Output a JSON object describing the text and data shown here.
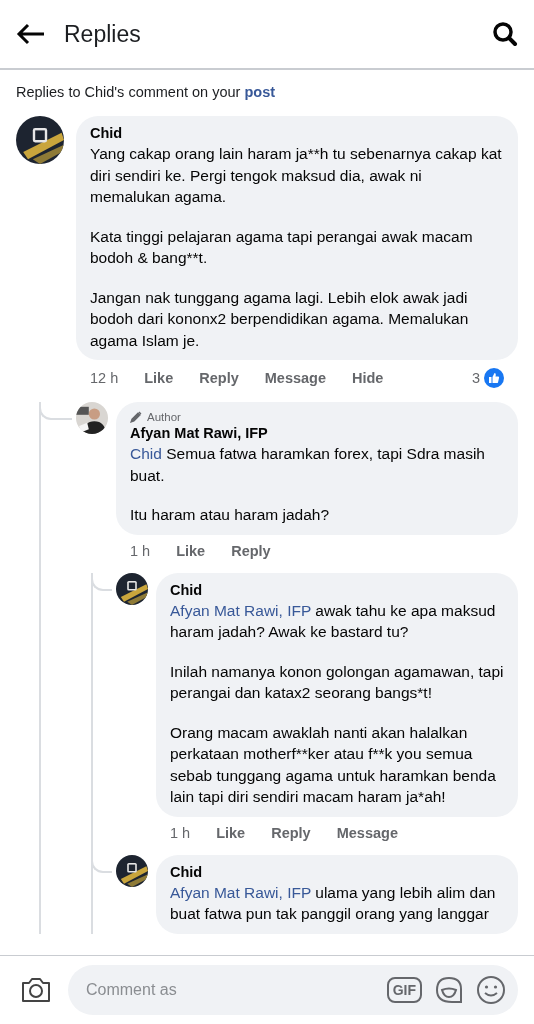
{
  "header": {
    "title": "Replies"
  },
  "context": {
    "text": "Replies to Chid's comment on your",
    "link": "post"
  },
  "comments": [
    {
      "author": "Chid",
      "paragraphs": [
        "Yang cakap orang lain haram ja**h tu sebenarnya cakap kat diri sendiri ke. Pergi tengok maksud dia, awak ni memalukan agama.",
        "Kata tinggi pelajaran agama tapi perangai awak macam bodoh & bang**t.",
        "Jangan nak tunggang agama lagi. Lebih elok awak jadi bodoh dari kononx2 berpendidikan agama. Memalukan agama Islam je."
      ],
      "time": "12 h",
      "actions": [
        "Like",
        "Reply",
        "Message",
        "Hide"
      ],
      "reactions": "3",
      "children": [
        {
          "author": "Afyan Mat Rawi, IFP",
          "badge": "Author",
          "mention": "Chid",
          "paragraphs": [
            "Semua fatwa haramkan forex, tapi Sdra masih buat.",
            "Itu haram atau haram jadah?"
          ],
          "time": "1 h",
          "actions": [
            "Like",
            "Reply"
          ],
          "children": [
            {
              "author": "Chid",
              "mention": "Afyan Mat Rawi, IFP",
              "paragraphs": [
                "awak tahu ke apa maksud haram jadah? Awak ke bastard tu?",
                "Inilah namanya konon golongan agamawan, tapi perangai dan katax2 seorang bangs*t!",
                "Orang macam awaklah nanti akan halalkan perkataan motherf**ker atau f**k you semua sebab tunggang agama untuk haramkan benda lain tapi diri sendiri macam haram ja*ah!"
              ],
              "time": "1 h",
              "actions": [
                "Like",
                "Reply",
                "Message"
              ]
            },
            {
              "author": "Chid",
              "mention": "Afyan Mat Rawi, IFP",
              "paragraphs": [
                "ulama yang lebih alim dan buat fatwa pun tak panggil orang yang langgar"
              ]
            }
          ]
        }
      ]
    }
  ],
  "composer": {
    "placeholder": "Comment as",
    "gif_label": "GIF"
  }
}
